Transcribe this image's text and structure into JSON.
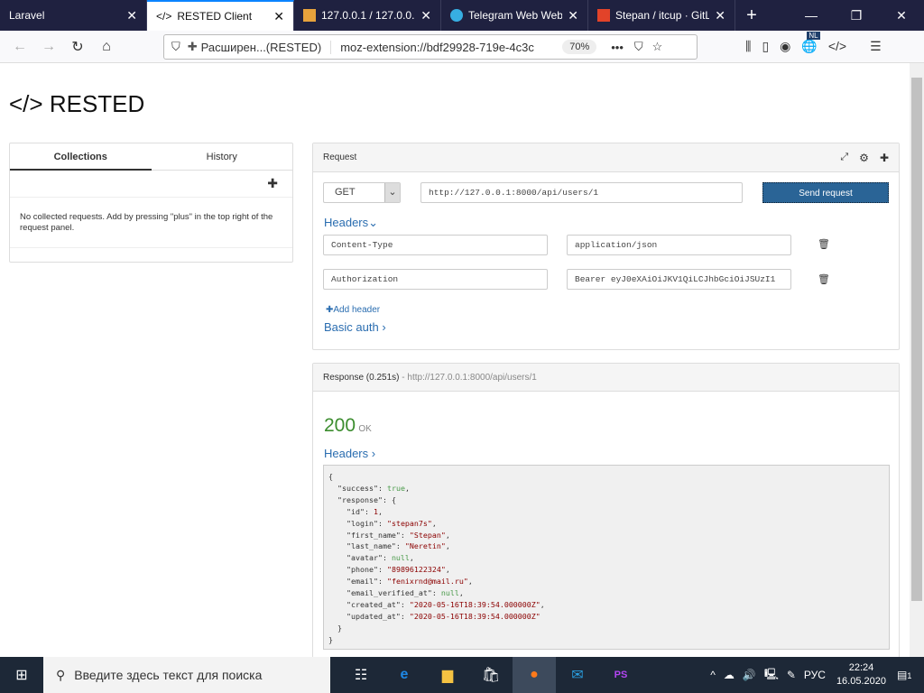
{
  "browser": {
    "tabs": [
      {
        "title": "Laravel",
        "icon": "none"
      },
      {
        "title": "RESTED Client",
        "icon": "code-icon",
        "active": true
      },
      {
        "title": "127.0.0.1 / 127.0.0.1",
        "icon": "phpmyadmin-icon"
      },
      {
        "title": "Telegram Web Web",
        "icon": "telegram-icon"
      },
      {
        "title": "Stepan / itcup · GitL",
        "icon": "gitlab-icon"
      }
    ],
    "identity": "Расширен...(RESTED)",
    "url": "moz-extension://bdf29928-719e-4c3c",
    "zoom": "70%",
    "new_tab": "+",
    "vpn_badge": "NL"
  },
  "app": {
    "title": "RESTED"
  },
  "sidebar": {
    "tabs": [
      "Collections",
      "History"
    ],
    "empty_text": "No collected requests. Add by pressing \"plus\" in the top right of the request panel."
  },
  "request": {
    "title": "Request",
    "method": "GET",
    "url": "http://127.0.0.1:8000/api/users/1",
    "send_label": "Send request",
    "headers_label": "Headers",
    "headers": [
      {
        "name": "Content-Type",
        "value": "application/json"
      },
      {
        "name": "Authorization",
        "value": "Bearer eyJ0eXAiOiJKV1QiLCJhbGciOiJSUzI1"
      }
    ],
    "add_header": "Add header",
    "basic_auth": "Basic auth"
  },
  "response": {
    "title": "Response (0.251s)",
    "url": "http://127.0.0.1:8000/api/users/1",
    "status_code": "200",
    "status_text": "OK",
    "headers_label": "Headers",
    "body_lines": [
      {
        "indent": 0,
        "text": "{"
      },
      {
        "indent": 1,
        "key": "success",
        "value": "true",
        "type": "b",
        "end": ","
      },
      {
        "indent": 1,
        "key": "response",
        "value": "{",
        "type": "p",
        "end": ""
      },
      {
        "indent": 2,
        "key": "id",
        "value": "1",
        "type": "n",
        "end": ","
      },
      {
        "indent": 2,
        "key": "login",
        "value": "\"stepan7s\"",
        "type": "s",
        "end": ","
      },
      {
        "indent": 2,
        "key": "first_name",
        "value": "\"Stepan\"",
        "type": "s",
        "end": ","
      },
      {
        "indent": 2,
        "key": "last_name",
        "value": "\"Neretin\"",
        "type": "s",
        "end": ","
      },
      {
        "indent": 2,
        "key": "avatar",
        "value": "null",
        "type": "b",
        "end": ","
      },
      {
        "indent": 2,
        "key": "phone",
        "value": "\"89896122324\"",
        "type": "s",
        "end": ","
      },
      {
        "indent": 2,
        "key": "email",
        "value": "\"fenixrnd@mail.ru\"",
        "type": "s",
        "end": ","
      },
      {
        "indent": 2,
        "key": "email_verified_at",
        "value": "null",
        "type": "b",
        "end": ","
      },
      {
        "indent": 2,
        "key": "created_at",
        "value": "\"2020-05-16T18:39:54.000000Z\"",
        "type": "s",
        "end": ","
      },
      {
        "indent": 2,
        "key": "updated_at",
        "value": "\"2020-05-16T18:39:54.000000Z\"",
        "type": "s",
        "end": ""
      },
      {
        "indent": 1,
        "text": "}"
      },
      {
        "indent": 0,
        "text": "}"
      }
    ]
  },
  "taskbar": {
    "search_placeholder": "Введите здесь текст для поиска",
    "lang": "РУС",
    "time": "22:24",
    "date": "16.05.2020",
    "notifications": "1"
  }
}
